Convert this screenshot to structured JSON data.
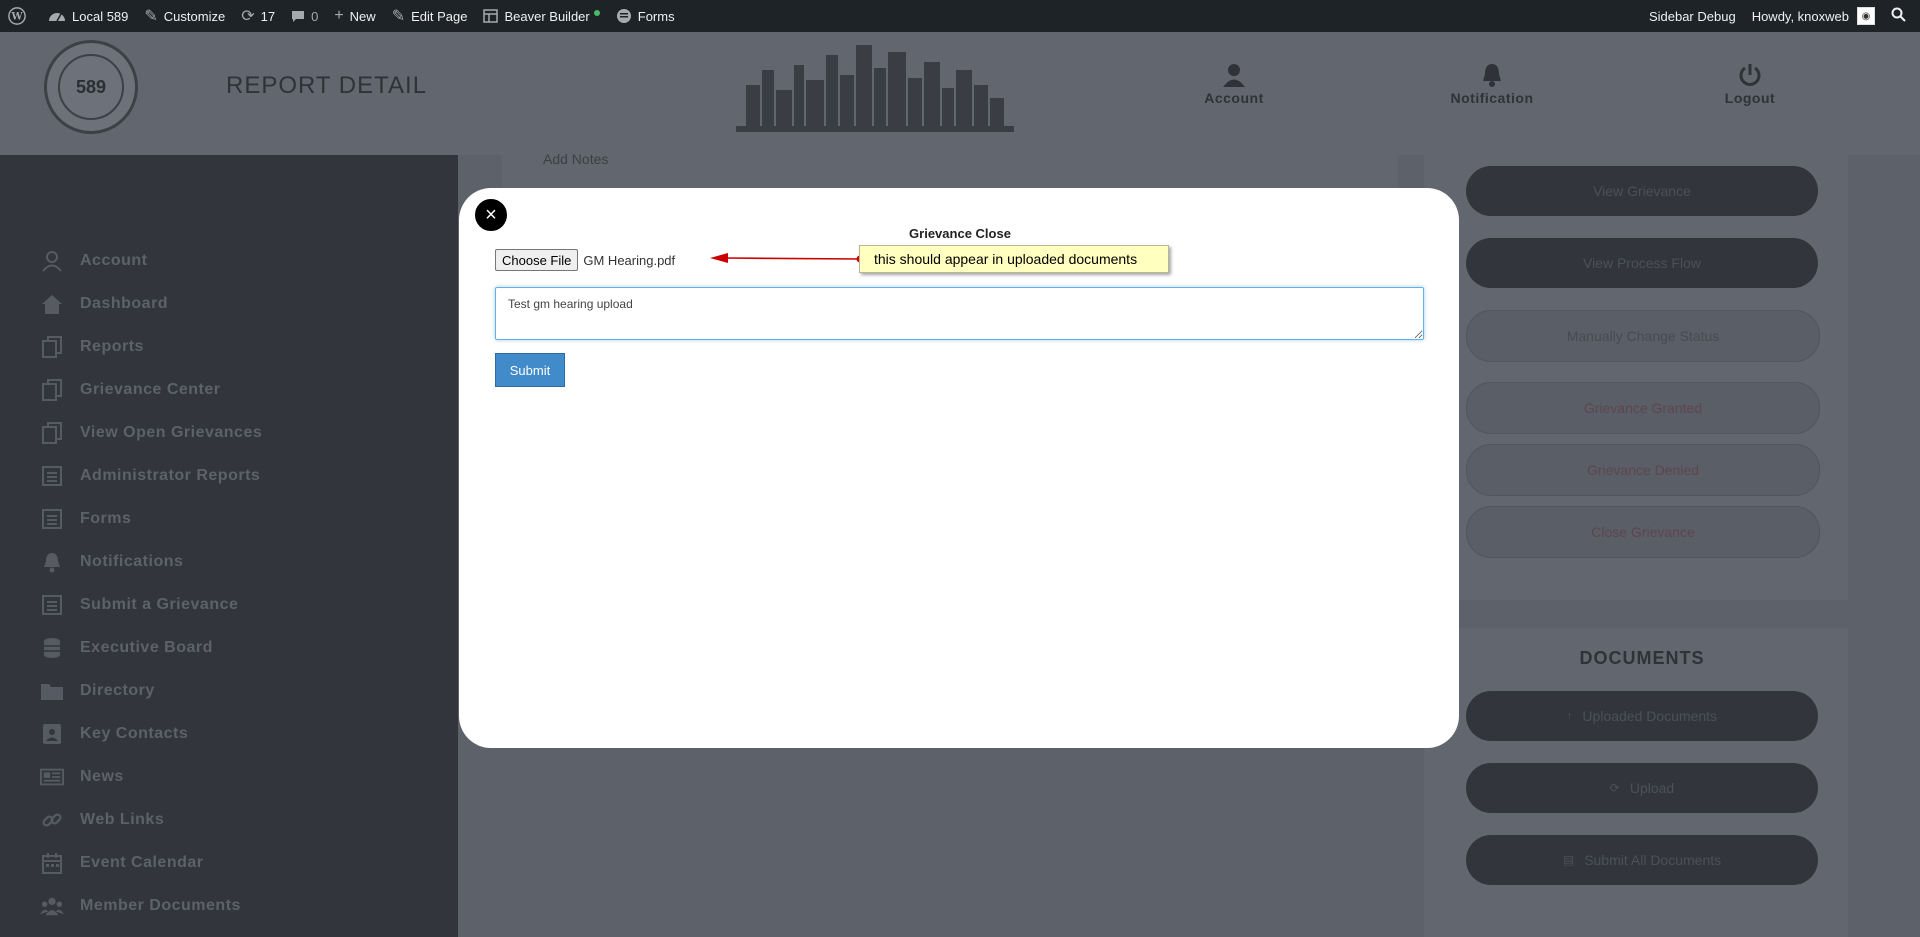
{
  "adminbar": {
    "site_name": "Local 589",
    "customize": "Customize",
    "updates_count": "17",
    "comments_count": "0",
    "new": "New",
    "edit_page": "Edit Page",
    "beaver_builder": "Beaver Builder",
    "forms": "Forms",
    "sidebar_debug": "Sidebar Debug",
    "howdy": "Howdy, knoxweb"
  },
  "header": {
    "logo_text": "589",
    "page_title": "REPORT DETAIL",
    "nav": [
      {
        "label": "Account",
        "icon": "user-icon"
      },
      {
        "label": "Notification",
        "icon": "bell-icon"
      },
      {
        "label": "Logout",
        "icon": "power-icon"
      }
    ]
  },
  "sidebar": {
    "items": [
      {
        "label": "Account",
        "icon": "user-icon"
      },
      {
        "label": "Dashboard",
        "icon": "home-icon"
      },
      {
        "label": "Reports",
        "icon": "copy-icon"
      },
      {
        "label": "Grievance Center",
        "icon": "copy-icon"
      },
      {
        "label": "View Open Grievances",
        "icon": "copy-icon"
      },
      {
        "label": "Administrator Reports",
        "icon": "list-icon"
      },
      {
        "label": "Forms",
        "icon": "list-icon"
      },
      {
        "label": "Notifications",
        "icon": "bell-icon"
      },
      {
        "label": "Submit a Grievance",
        "icon": "list-icon"
      },
      {
        "label": "Executive Board",
        "icon": "database-icon"
      },
      {
        "label": "Directory",
        "icon": "folder-icon"
      },
      {
        "label": "Key Contacts",
        "icon": "contact-icon"
      },
      {
        "label": "News",
        "icon": "news-icon"
      },
      {
        "label": "Web Links",
        "icon": "link-icon"
      },
      {
        "label": "Event Calendar",
        "icon": "calendar-icon"
      },
      {
        "label": "Member Documents",
        "icon": "users-icon"
      }
    ]
  },
  "main": {
    "notes_label": "Add Notes",
    "actions": [
      "View Grievance",
      "View Process Flow",
      "Manually Change Status",
      "Grievance Granted",
      "Grievance Denied",
      "Close Grievance"
    ],
    "documents_title": "DOCUMENTS",
    "documents": [
      "Uploaded Documents",
      "Upload",
      "Submit All Documents"
    ]
  },
  "modal": {
    "title": "Grievance Close",
    "choose_file": "Choose File",
    "file_name": "GM Hearing.pdf",
    "notes_value": "Test gm hearing upload",
    "submit": "Submit",
    "close_symbol": "×"
  },
  "annotation": {
    "text": "this should appear in uploaded documents",
    "color": "#cc0000"
  }
}
